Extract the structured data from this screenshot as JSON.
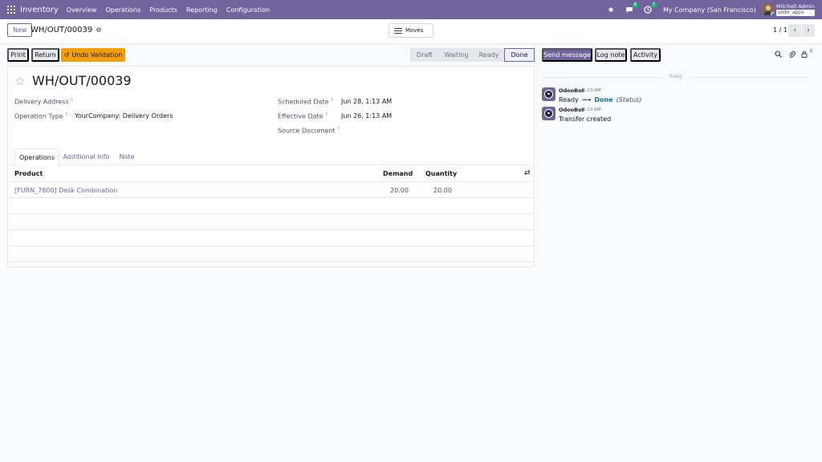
{
  "navbar": {
    "brand": "Inventory",
    "menu": [
      "Overview",
      "Operations",
      "Products",
      "Reporting",
      "Configuration"
    ],
    "messages_badge": "8",
    "activities_badge": "7",
    "company": "My Company (San Francisco)",
    "user_name": "Mitchell Admin",
    "database": "undo_apps"
  },
  "control_panel": {
    "new_label": "New",
    "breadcrumb": "WH/OUT/00039",
    "moves_label": "Moves",
    "pager": "1 / 1"
  },
  "status_bar": {
    "buttons": {
      "print": "Print",
      "return": "Return",
      "undo_validation": "Undo Validation"
    },
    "stages": [
      "Draft",
      "Waiting",
      "Ready",
      "Done"
    ],
    "current_stage": "Done"
  },
  "record": {
    "title": "WH/OUT/00039",
    "fields": {
      "delivery_address_label": "Delivery Address",
      "operation_type_label": "Operation Type",
      "operation_type_value": "YourCompany: Delivery Orders",
      "scheduled_date_label": "Scheduled Date",
      "scheduled_date_value": "Jun 28, 1:13 AM",
      "effective_date_label": "Effective Date",
      "effective_date_value": "Jun 26, 1:13 AM",
      "source_document_label": "Source Document",
      "help_mark": "?"
    },
    "tabs": [
      "Operations",
      "Additional Info",
      "Note"
    ],
    "table": {
      "headers": {
        "product": "Product",
        "demand": "Demand",
        "quantity": "Quantity"
      },
      "rows": [
        {
          "product": "[FURN_7800] Desk Combination",
          "demand": "20.00",
          "quantity": "20.00"
        }
      ]
    }
  },
  "chatter": {
    "buttons": {
      "send_message": "Send message",
      "log_note": "Log note",
      "activity": "Activity"
    },
    "followers_count": "0",
    "date_divider": "Today",
    "messages": [
      {
        "author": "OdooBot",
        "time": "1:13 AM",
        "from": "Ready",
        "to": "Done",
        "tag": "(Status)"
      },
      {
        "author": "OdooBot",
        "time": "1:13 AM",
        "body": "Transfer created"
      }
    ]
  }
}
